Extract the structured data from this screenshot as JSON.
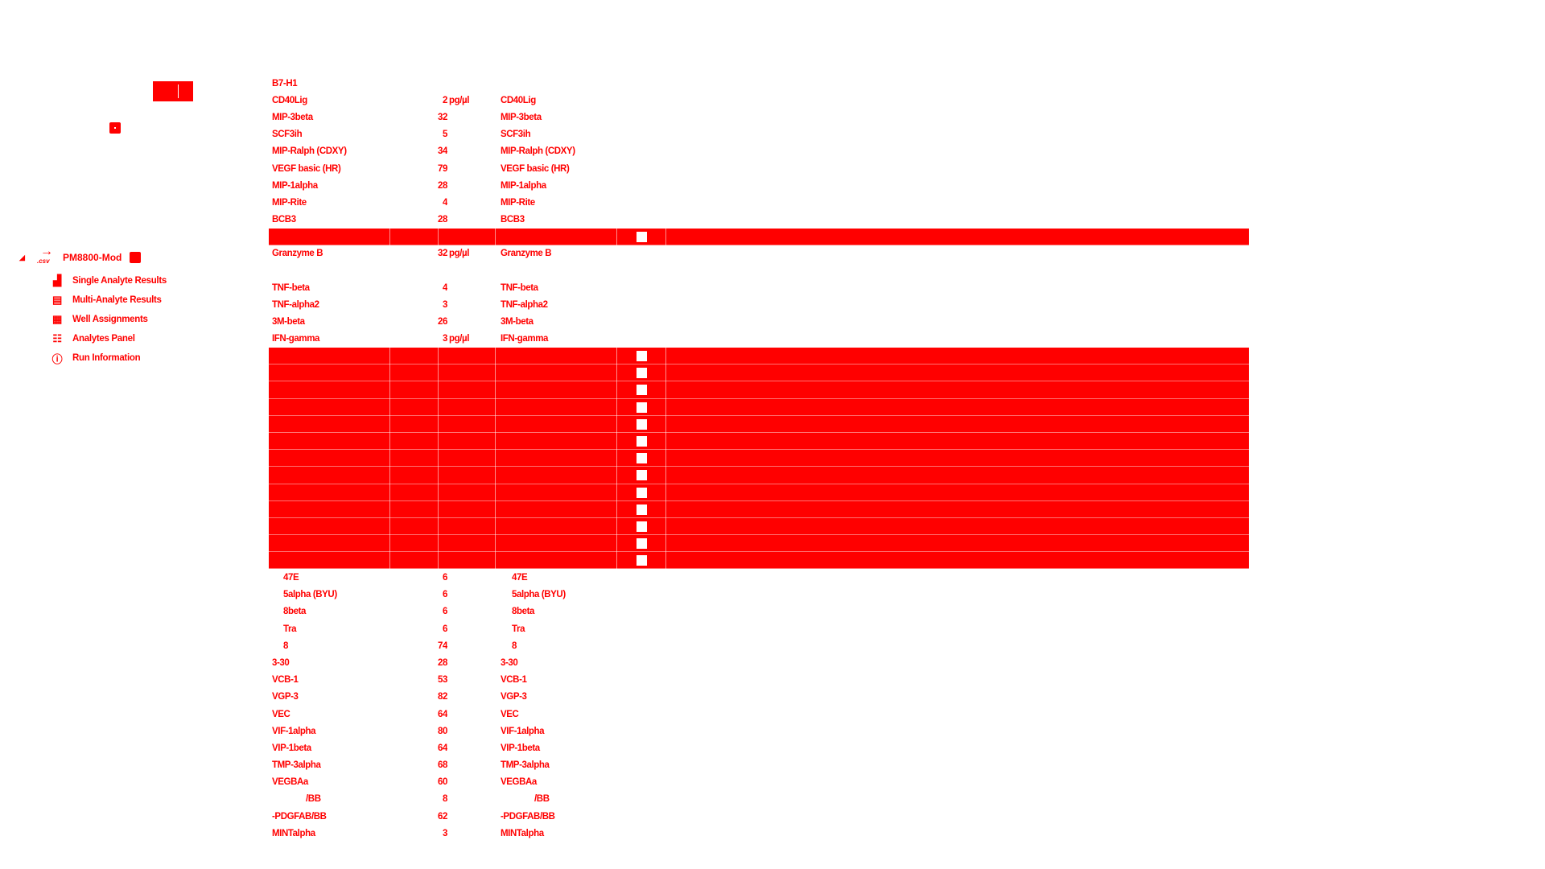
{
  "tree": {
    "root_label": "PM8800-Mod",
    "root_icon": "csv-file-icon",
    "csv_ext": ".csv",
    "items": [
      {
        "label": "Single Analyte Results",
        "icon": "bar-chart-icon"
      },
      {
        "label": "Multi-Analyte Results",
        "icon": "clipboard-icon"
      },
      {
        "label": "Well Assignments",
        "icon": "grid-icon"
      },
      {
        "label": "Analytes Panel",
        "icon": "panel-icon"
      },
      {
        "label": "Run Information",
        "icon": "info-icon"
      }
    ]
  },
  "table": {
    "rows": [
      {
        "type": "text",
        "name": "B7-H1",
        "value": "",
        "unit": "",
        "name2": ""
      },
      {
        "type": "text",
        "name": "CD40Lig",
        "value": "2",
        "unit": "pg/µl",
        "name2": "CD40Lig"
      },
      {
        "type": "text",
        "name": "MIP-3beta",
        "value": "32",
        "unit": "",
        "name2": "MIP-3beta"
      },
      {
        "type": "text",
        "name": "SCF3ih",
        "value": "5",
        "unit": "",
        "name2": "SCF3ih"
      },
      {
        "type": "text",
        "name": "MIP-Ralph (CDXY)",
        "value": "34",
        "unit": "",
        "name2": "MIP-Ralph (CDXY)"
      },
      {
        "type": "text",
        "name": "VEGF basic (HR)",
        "value": "79",
        "unit": "",
        "name2": "VEGF basic (HR)"
      },
      {
        "type": "text",
        "name": "MIP-1alpha",
        "value": "28",
        "unit": "",
        "name2": "MIP-1alpha"
      },
      {
        "type": "text",
        "name": "MIP-Rite",
        "value": "4",
        "unit": "",
        "name2": "MIP-Rite"
      },
      {
        "type": "text",
        "name": "BCB3",
        "value": "28",
        "unit": "",
        "name2": "BCB3"
      },
      {
        "type": "highlight"
      },
      {
        "type": "text",
        "name": "Granzyme B",
        "value": "32",
        "unit": "pg/µl",
        "name2": "Granzyme B"
      },
      {
        "type": "gap"
      },
      {
        "type": "text",
        "name": "TNF-beta",
        "value": "4",
        "unit": "",
        "name2": "TNF-beta"
      },
      {
        "type": "text",
        "name": "TNF-alpha2",
        "value": "3",
        "unit": "",
        "name2": "TNF-alpha2"
      },
      {
        "type": "text",
        "name": "3M-beta",
        "value": "26",
        "unit": "",
        "name2": "3M-beta"
      },
      {
        "type": "text",
        "name": "IFN-gamma",
        "value": "3",
        "unit": "pg/µl",
        "name2": "IFN-gamma"
      },
      {
        "type": "highlight"
      },
      {
        "type": "highlight"
      },
      {
        "type": "highlight"
      },
      {
        "type": "highlight"
      },
      {
        "type": "highlight"
      },
      {
        "type": "highlight"
      },
      {
        "type": "highlight"
      },
      {
        "type": "highlight"
      },
      {
        "type": "highlight"
      },
      {
        "type": "highlight"
      },
      {
        "type": "highlight"
      },
      {
        "type": "highlight"
      },
      {
        "type": "highlight"
      },
      {
        "type": "text",
        "name": "47E",
        "value": "6",
        "unit": "",
        "name2": "47E",
        "indent": true
      },
      {
        "type": "text",
        "name": "5alpha (BYU)",
        "value": "6",
        "unit": "",
        "name2": "5alpha (BYU)",
        "indent": true
      },
      {
        "type": "text",
        "name": "8beta",
        "value": "6",
        "unit": "",
        "name2": "8beta",
        "indent": true
      },
      {
        "type": "text",
        "name": "Tra",
        "value": "6",
        "unit": "",
        "name2": "Tra",
        "indent": true
      },
      {
        "type": "text",
        "name": "8",
        "value": "74",
        "unit": "",
        "name2": "8",
        "indent": true
      },
      {
        "type": "text",
        "name": "3-30",
        "value": "28",
        "unit": "",
        "name2": "3-30"
      },
      {
        "type": "text",
        "name": "VCB-1",
        "value": "53",
        "unit": "",
        "name2": "VCB-1"
      },
      {
        "type": "text",
        "name": "VGP-3",
        "value": "82",
        "unit": "",
        "name2": "VGP-3"
      },
      {
        "type": "text",
        "name": "VEC",
        "value": "64",
        "unit": "",
        "name2": "VEC"
      },
      {
        "type": "text",
        "name": "VIF-1alpha",
        "value": "80",
        "unit": "",
        "name2": "VIF-1alpha"
      },
      {
        "type": "text",
        "name": "VIP-1beta",
        "value": "64",
        "unit": "",
        "name2": "VIP-1beta"
      },
      {
        "type": "text",
        "name": "TMP-3alpha",
        "value": "68",
        "unit": "",
        "name2": "TMP-3alpha"
      },
      {
        "type": "text",
        "name": "VEGBAa",
        "value": "60",
        "unit": "",
        "name2": "VEGBAa"
      },
      {
        "type": "text",
        "name": "/BB",
        "value": "8",
        "unit": "",
        "name2": "/BB",
        "wide_indent": true
      },
      {
        "type": "text",
        "name": "-PDGFAB/BB",
        "value": "62",
        "unit": "",
        "name2": "-PDGFAB/BB"
      },
      {
        "type": "text",
        "name": "MINTalpha",
        "value": "3",
        "unit": "",
        "name2": "MINTalpha"
      }
    ]
  },
  "colors": {
    "accent": "#ff0000",
    "background": "#ffffff",
    "checkbox": "#ffffff"
  }
}
